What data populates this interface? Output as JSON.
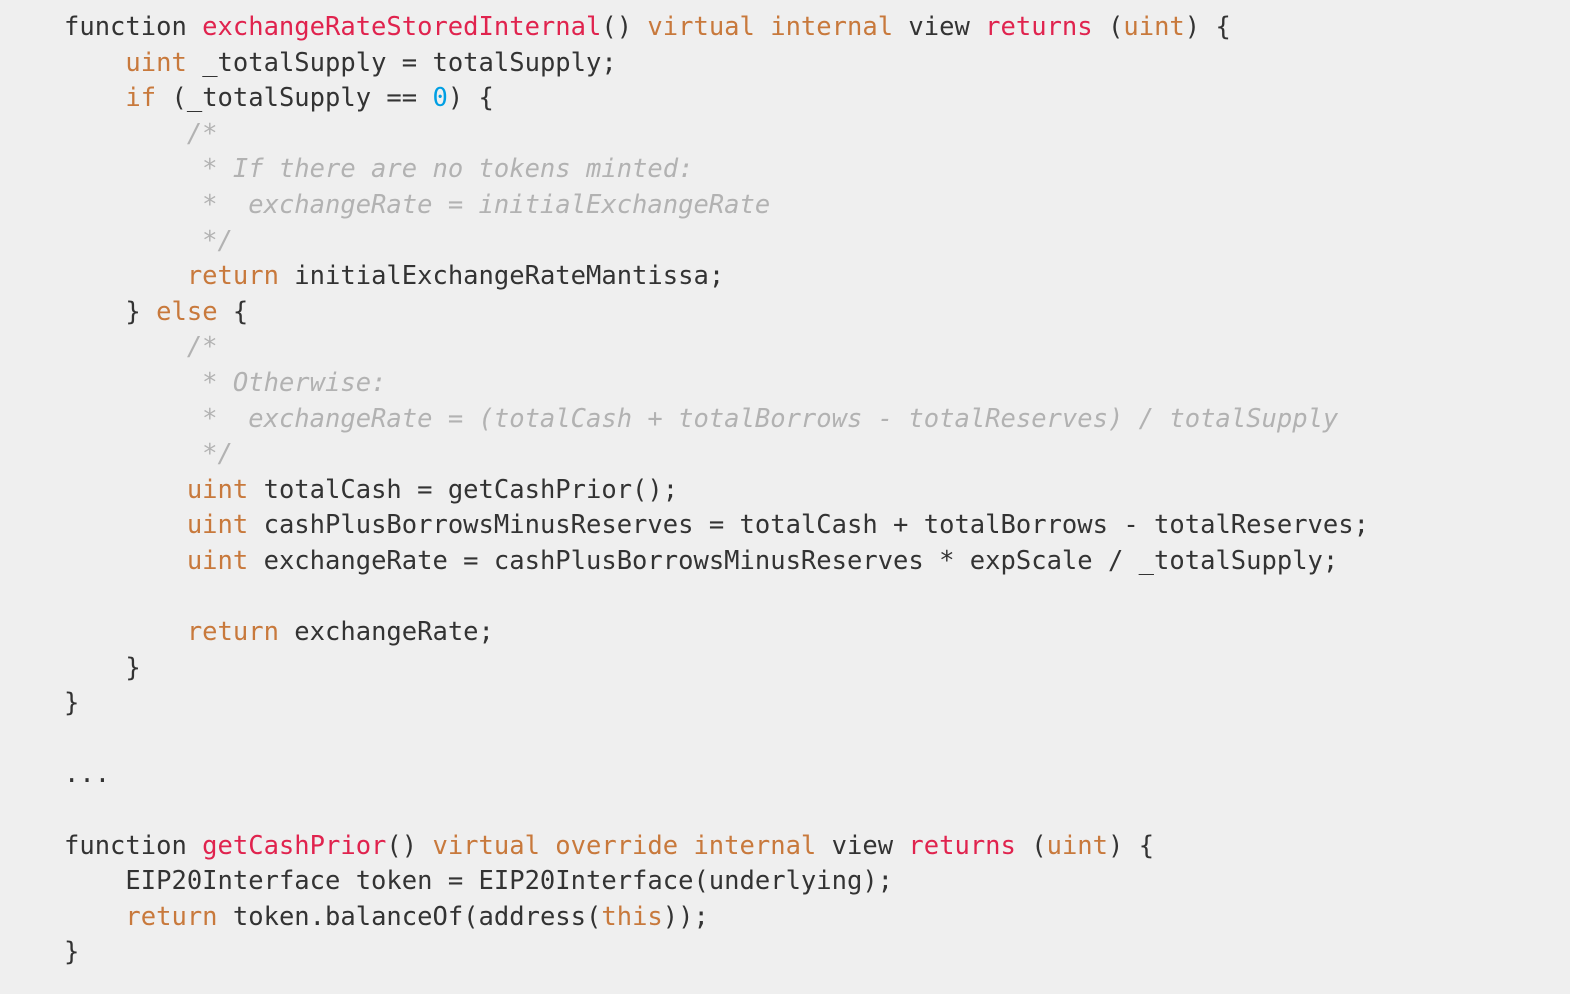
{
  "code_block": {
    "language": "solidity",
    "background_color": "#efefef",
    "colors": {
      "text": "#333333",
      "keyword": "#c8793c",
      "function_name": "#e0234e",
      "number": "#009fe3",
      "comment": "#b2b2b2"
    },
    "lines": [
      {
        "id": "line-1",
        "indent": 0,
        "tokens": [
          {
            "t": "plain",
            "v": "function "
          },
          {
            "t": "fn",
            "v": "exchangeRateStoredInternal"
          },
          {
            "t": "plain",
            "v": "() "
          },
          {
            "t": "kw",
            "v": "virtual internal"
          },
          {
            "t": "plain",
            "v": " view "
          },
          {
            "t": "fn",
            "v": "returns"
          },
          {
            "t": "plain",
            "v": " ("
          },
          {
            "t": "kw",
            "v": "uint"
          },
          {
            "t": "plain",
            "v": ") {"
          }
        ]
      },
      {
        "id": "line-2",
        "indent": 1,
        "tokens": [
          {
            "t": "kw",
            "v": "uint"
          },
          {
            "t": "plain",
            "v": " _totalSupply = totalSupply;"
          }
        ]
      },
      {
        "id": "line-3",
        "indent": 1,
        "tokens": [
          {
            "t": "kw",
            "v": "if"
          },
          {
            "t": "plain",
            "v": " (_totalSupply == "
          },
          {
            "t": "num",
            "v": "0"
          },
          {
            "t": "plain",
            "v": ") {"
          }
        ]
      },
      {
        "id": "line-4",
        "indent": 2,
        "tokens": [
          {
            "t": "comment",
            "v": "/*"
          }
        ]
      },
      {
        "id": "line-5",
        "indent": 2,
        "tokens": [
          {
            "t": "comment",
            "v": " * If there are no tokens minted:"
          }
        ]
      },
      {
        "id": "line-6",
        "indent": 2,
        "tokens": [
          {
            "t": "comment",
            "v": " *  exchangeRate = initialExchangeRate"
          }
        ]
      },
      {
        "id": "line-7",
        "indent": 2,
        "tokens": [
          {
            "t": "comment",
            "v": " */"
          }
        ]
      },
      {
        "id": "line-8",
        "indent": 2,
        "tokens": [
          {
            "t": "kw",
            "v": "return"
          },
          {
            "t": "plain",
            "v": " initialExchangeRateMantissa;"
          }
        ]
      },
      {
        "id": "line-9",
        "indent": 1,
        "tokens": [
          {
            "t": "plain",
            "v": "} "
          },
          {
            "t": "kw",
            "v": "else"
          },
          {
            "t": "plain",
            "v": " {"
          }
        ]
      },
      {
        "id": "line-10",
        "indent": 2,
        "tokens": [
          {
            "t": "comment",
            "v": "/*"
          }
        ]
      },
      {
        "id": "line-11",
        "indent": 2,
        "tokens": [
          {
            "t": "comment",
            "v": " * Otherwise:"
          }
        ]
      },
      {
        "id": "line-12",
        "indent": 2,
        "tokens": [
          {
            "t": "comment",
            "v": " *  exchangeRate = (totalCash + totalBorrows - totalReserves) / totalSupply"
          }
        ]
      },
      {
        "id": "line-13",
        "indent": 2,
        "tokens": [
          {
            "t": "comment",
            "v": " */"
          }
        ]
      },
      {
        "id": "line-14",
        "indent": 2,
        "tokens": [
          {
            "t": "kw",
            "v": "uint"
          },
          {
            "t": "plain",
            "v": " totalCash = getCashPrior();"
          }
        ]
      },
      {
        "id": "line-15",
        "indent": 2,
        "tokens": [
          {
            "t": "kw",
            "v": "uint"
          },
          {
            "t": "plain",
            "v": " cashPlusBorrowsMinusReserves = totalCash + totalBorrows - totalReserves;"
          }
        ]
      },
      {
        "id": "line-16",
        "indent": 2,
        "tokens": [
          {
            "t": "kw",
            "v": "uint"
          },
          {
            "t": "plain",
            "v": " exchangeRate = cashPlusBorrowsMinusReserves * expScale / _totalSupply;"
          }
        ]
      },
      {
        "id": "line-17",
        "indent": 0,
        "tokens": []
      },
      {
        "id": "line-18",
        "indent": 2,
        "tokens": [
          {
            "t": "kw",
            "v": "return"
          },
          {
            "t": "plain",
            "v": " exchangeRate;"
          }
        ]
      },
      {
        "id": "line-19",
        "indent": 1,
        "tokens": [
          {
            "t": "plain",
            "v": "}"
          }
        ]
      },
      {
        "id": "line-20",
        "indent": 0,
        "tokens": [
          {
            "t": "plain",
            "v": "}"
          }
        ]
      },
      {
        "id": "line-21",
        "indent": 0,
        "tokens": []
      },
      {
        "id": "line-22",
        "indent": 0,
        "tokens": [
          {
            "t": "plain",
            "v": "..."
          }
        ]
      },
      {
        "id": "line-23",
        "indent": 0,
        "tokens": []
      },
      {
        "id": "line-24",
        "indent": 0,
        "tokens": [
          {
            "t": "plain",
            "v": "function "
          },
          {
            "t": "fn",
            "v": "getCashPrior"
          },
          {
            "t": "plain",
            "v": "() "
          },
          {
            "t": "kw",
            "v": "virtual override internal"
          },
          {
            "t": "plain",
            "v": " view "
          },
          {
            "t": "fn",
            "v": "returns"
          },
          {
            "t": "plain",
            "v": " ("
          },
          {
            "t": "kw",
            "v": "uint"
          },
          {
            "t": "plain",
            "v": ") {"
          }
        ]
      },
      {
        "id": "line-25",
        "indent": 1,
        "tokens": [
          {
            "t": "plain",
            "v": "EIP20Interface token = EIP20Interface(underlying);"
          }
        ]
      },
      {
        "id": "line-26",
        "indent": 1,
        "tokens": [
          {
            "t": "kw",
            "v": "return"
          },
          {
            "t": "plain",
            "v": " token.balanceOf(address("
          },
          {
            "t": "kw",
            "v": "this"
          },
          {
            "t": "plain",
            "v": "));"
          }
        ]
      },
      {
        "id": "line-27",
        "indent": 0,
        "tokens": [
          {
            "t": "plain",
            "v": "}"
          }
        ]
      }
    ]
  }
}
